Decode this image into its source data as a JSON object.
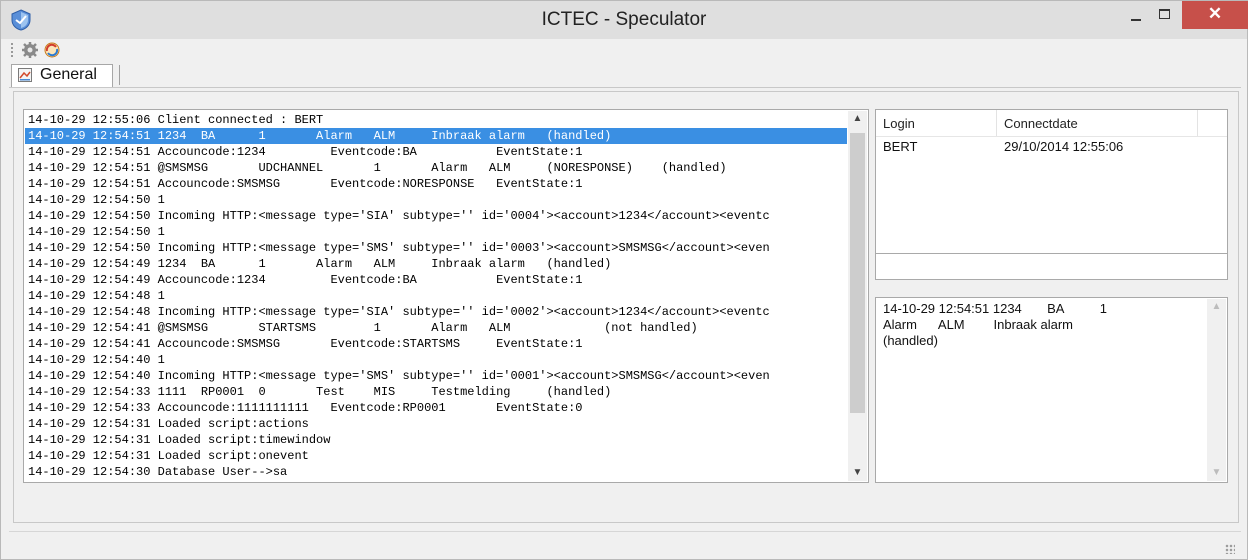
{
  "window": {
    "title": "ICTEC - Speculator",
    "controls": {
      "minimize": "minimize",
      "maximize": "maximize",
      "close": "✕"
    }
  },
  "toolbar": {
    "items": [
      {
        "icon": "settings-gear-icon"
      },
      {
        "icon": "refresh-tool-icon"
      }
    ]
  },
  "tabs": [
    {
      "label": "General",
      "icon": "general-tab-icon",
      "active": true
    }
  ],
  "log": {
    "lines": [
      "14-10-29 12:55:06 Client connected : BERT",
      "14-10-29 12:54:51 1234  BA      1       Alarm   ALM     Inbraak alarm   (handled)",
      "14-10-29 12:54:51 Accouncode:1234         Eventcode:BA           EventState:1",
      "14-10-29 12:54:51 @SMSMSG       UDCHANNEL       1       Alarm   ALM     (NORESPONSE)    (handled)",
      "14-10-29 12:54:51 Accouncode:SMSMSG       Eventcode:NORESPONSE   EventState:1",
      "14-10-29 12:54:50 1",
      "14-10-29 12:54:50 Incoming HTTP:<message type='SIA' subtype='' id='0004'><account>1234</account><eventc",
      "14-10-29 12:54:50 1",
      "14-10-29 12:54:50 Incoming HTTP:<message type='SMS' subtype='' id='0003'><account>SMSMSG</account><even",
      "14-10-29 12:54:49 1234  BA      1       Alarm   ALM     Inbraak alarm   (handled)",
      "14-10-29 12:54:49 Accouncode:1234         Eventcode:BA           EventState:1",
      "14-10-29 12:54:48 1",
      "14-10-29 12:54:48 Incoming HTTP:<message type='SIA' subtype='' id='0002'><account>1234</account><eventc",
      "14-10-29 12:54:41 @SMSMSG       STARTSMS        1       Alarm   ALM             (not handled)",
      "14-10-29 12:54:41 Accouncode:SMSMSG       Eventcode:STARTSMS     EventState:1",
      "14-10-29 12:54:40 1",
      "14-10-29 12:54:40 Incoming HTTP:<message type='SMS' subtype='' id='0001'><account>SMSMSG</account><even",
      "14-10-29 12:54:33 1111  RP0001  0       Test    MIS     Testmelding     (handled)",
      "14-10-29 12:54:33 Accouncode:1111111111   Eventcode:RP0001       EventState:0",
      "14-10-29 12:54:31 Loaded script:actions",
      "14-10-29 12:54:31 Loaded script:timewindow",
      "14-10-29 12:54:31 Loaded script:onevent",
      "14-10-29 12:54:30 Database User-->sa"
    ],
    "selected_index": 1
  },
  "clients": {
    "columns": [
      "Login",
      "Connectdate"
    ],
    "rows": [
      {
        "login": "BERT",
        "connectdate": "29/10/2014 12:55:06"
      }
    ]
  },
  "message_field": {
    "value": ""
  },
  "detail": {
    "text": "14-10-29 12:54:51 1234       BA          1\nAlarm      ALM        Inbraak alarm\n(handled)"
  },
  "colors": {
    "selection": "#3a8fe3",
    "close_button": "#c7504a",
    "titlebar": "#dfdfdf"
  }
}
